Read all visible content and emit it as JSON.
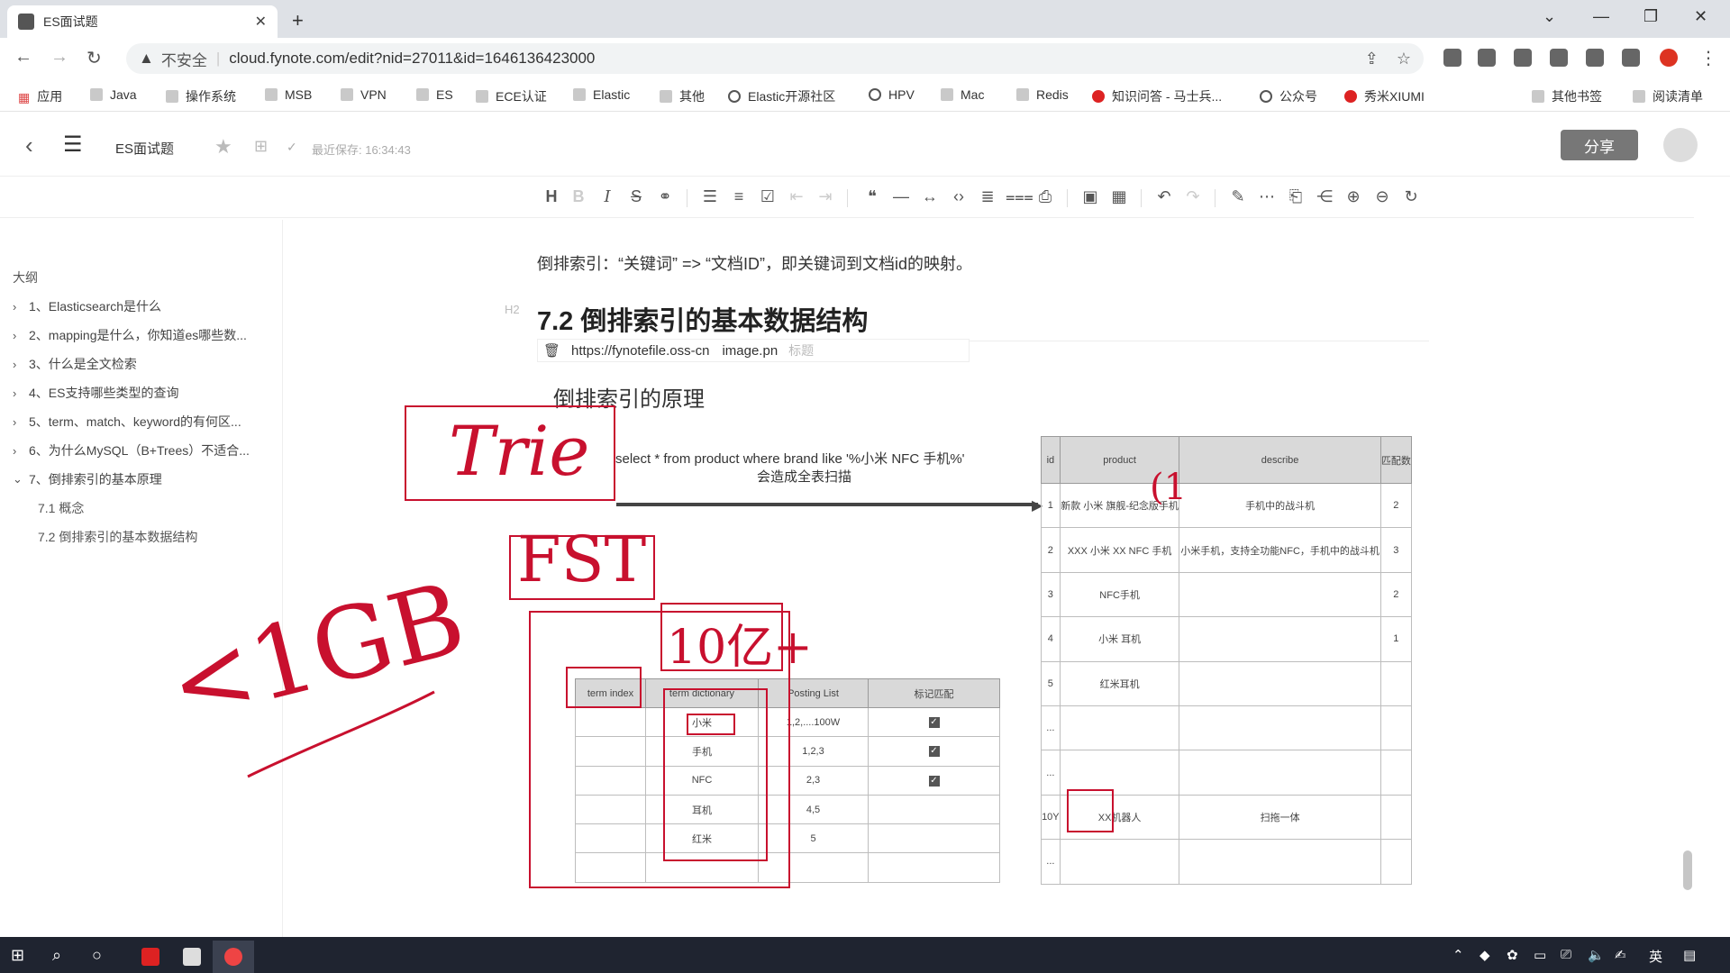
{
  "browser": {
    "tab_title": "ES面试题",
    "new_tab": "+",
    "address": {
      "warning_icon": "warning-triangle-icon",
      "insecure_label": "不安全",
      "url": "cloud.fynote.com/edit?nid=27011&id=1646136423000"
    },
    "bookmarks": [
      "应用",
      "Java",
      "操作系统",
      "MSB",
      "VPN",
      "ES",
      "ECE认证",
      "Elastic",
      "其他",
      "Elastic开源社区",
      "HPV",
      "Mac",
      "Redis",
      "知识问答 - 马士兵...",
      "公众号",
      "秀米XIUMI",
      "其他书签",
      "阅读清单"
    ]
  },
  "app": {
    "doc_title": "ES面试题",
    "last_saved": "最近保存: 16:34:43",
    "share_label": "分享"
  },
  "outline": {
    "title": "大纲",
    "items": [
      "1、Elasticsearch是什么",
      "2、mapping是什么，你知道es哪些数...",
      "3、什么是全文检索",
      "4、ES支持哪些类型的查询",
      "5、term、match、keyword的有何区...",
      "6、为什么MySQL（B+Trees）不适合...",
      "7、倒排索引的基本原理"
    ],
    "subitems": [
      "7.1 概念",
      "7.2 倒排索引的基本数据结构"
    ]
  },
  "doc": {
    "paragraph": "倒排索引：“关键词” => “文档ID”，即关键词到文档id的映射。",
    "h2_tag": "H2",
    "heading": "7.2 倒排索引的基本数据结构",
    "image_url": "https://fynotefile.oss-cn",
    "image_name": "image.pn",
    "image_caption_placeholder": "标题"
  },
  "figure": {
    "title": "倒排索引的原理",
    "sql": "select * from product where brand like '%小米 NFC 手机%'",
    "sql_note": "会造成全表扫描",
    "right_table": {
      "headers": [
        "id",
        "product",
        "describe",
        "匹配数"
      ],
      "rows": [
        [
          "1",
          "新款 小米 旗舰-纪念版手机",
          "手机中的战斗机",
          "2"
        ],
        [
          "2",
          "XXX 小米 XX NFC 手机",
          "小米手机，支持全功能NFC，手机中的战斗机",
          "3"
        ],
        [
          "3",
          "NFC手机",
          "",
          "2"
        ],
        [
          "4",
          "小米 耳机",
          "",
          "1"
        ],
        [
          "5",
          "红米耳机",
          "",
          ""
        ],
        [
          "...",
          "",
          "",
          ""
        ],
        [
          "...",
          "",
          "",
          ""
        ],
        [
          "10Y",
          "XX机器人",
          "扫拖一体",
          ""
        ],
        [
          "...",
          "",
          "",
          ""
        ]
      ]
    },
    "left_table": {
      "headers": [
        "term index",
        "term dictionary",
        "Posting List",
        "标记匹配"
      ],
      "rows": [
        [
          "",
          "小米",
          "1,2,....100W",
          "✓"
        ],
        [
          "",
          "手机",
          "1,2,3",
          "✓"
        ],
        [
          "",
          "NFC",
          "2,3",
          "✓"
        ],
        [
          "",
          "耳机",
          "4,5",
          ""
        ],
        [
          "",
          "红米",
          "5",
          ""
        ],
        [
          "",
          "",
          "",
          ""
        ]
      ]
    },
    "annotations": [
      "Trie",
      "FST",
      "10亿+",
      "<1GB",
      "(1"
    ]
  },
  "taskbar": {
    "tray_ime": "英"
  },
  "colors": {
    "annotation_red": "#c8102e",
    "share_button": "#777777",
    "taskbar": "#1f2430"
  }
}
